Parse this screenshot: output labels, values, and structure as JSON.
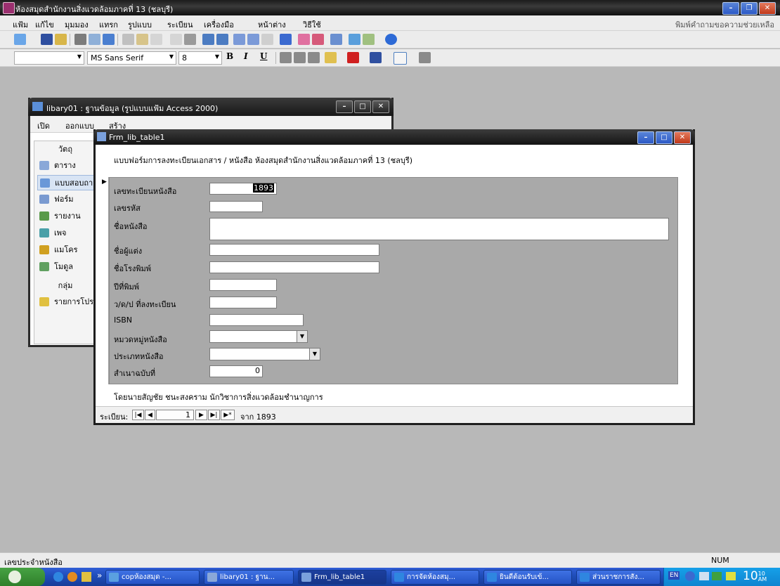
{
  "app": {
    "title": "ห้องสมุดสำนักงานสิ่งแวดล้อมภาคที่ 13 (ชลบุรี)"
  },
  "menu": {
    "items": [
      "แฟ้ม",
      "แก้ไข",
      "มุมมอง",
      "แทรก",
      "รูปแบบ",
      "ระเบียน",
      "เครื่องมือ",
      "หน้าต่าง",
      "วิธีใช้"
    ],
    "help_box": "พิมพ์คำถามขอความช่วยเหลือ"
  },
  "format_toolbar": {
    "font_name": "MS Sans Serif",
    "font_size": "8",
    "bold": "B",
    "italic": "I",
    "underline": "U"
  },
  "db_window": {
    "title": "libary01 : ฐานข้อมูล (รูปแบบแฟ้ม Access 2000)",
    "toolbar": {
      "open": "เปิด",
      "design": "ออกแบบ",
      "new": "สร้าง"
    },
    "objects_header": "วัตถุ",
    "objects": [
      "ตาราง",
      "แบบสอบถาม",
      "ฟอร์ม",
      "รายงาน",
      "เพจ",
      "แมโคร",
      "โมดูล"
    ],
    "groups_header": "กลุ่ม",
    "groups": [
      "รายการโปรด"
    ]
  },
  "form_window": {
    "title": "Frm_lib_table1",
    "header": "แบบฟอร์มการลงทะเบียนเอกสาร / หนังสือ ห้องสมุดสำนักงานสิ่งแวดล้อมภาคที่ 13 (ชลบุรี)",
    "fields": [
      {
        "label": "เลขทะเบียนหนังสือ",
        "value": "1893"
      },
      {
        "label": "เลขรหัส",
        "value": ""
      },
      {
        "label": "ชื่อหนังสือ",
        "value": ""
      },
      {
        "label": "ชื่อผู้แต่ง",
        "value": ""
      },
      {
        "label": "ชื่อโรงพิมพ์",
        "value": ""
      },
      {
        "label": "ปีที่พิมพ์",
        "value": ""
      },
      {
        "label": "ว/ด/ป ที่ลงทะเบียน",
        "value": ""
      },
      {
        "label": "ISBN",
        "value": ""
      },
      {
        "label": "หมวดหมู่หนังสือ",
        "value": ""
      },
      {
        "label": "ประเภทหนังสือ",
        "value": ""
      },
      {
        "label": "สำเนาฉบับที่",
        "value": "0"
      }
    ],
    "footer": "โดยนายสัญชัย ชนะสงคราม  นักวิชาการสิ่งแวดล้อมชำนาญการ",
    "nav": {
      "label": "ระเบียน:",
      "current": "1",
      "of_label": "จาก",
      "total": "1893"
    }
  },
  "status": {
    "left": "เลขประจำหนังสือ",
    "right": "NUM"
  },
  "taskbar": {
    "overflow": "»",
    "tasks": [
      "copห้องสมุด -...",
      "libary01 : ฐาน...",
      "Frm_lib_table1",
      "การจัดห้องสมุ...",
      "ยินดีต้อนรับเข้...",
      "ส่วนราชการสัง..."
    ],
    "lang": "EN",
    "clock": "10",
    "clock_suffix": "AM",
    "clock_top": "10"
  },
  "colors": {
    "detail_bg": "#a9a9a9",
    "taskbar": "#245edb",
    "title_dark": "#1c1c1c"
  }
}
